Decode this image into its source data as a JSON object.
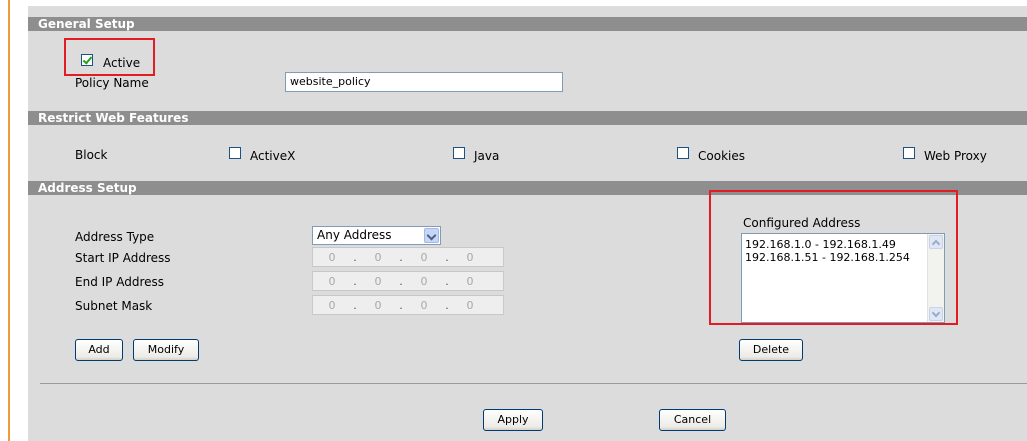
{
  "general_setup": {
    "title": "General Setup",
    "active_label": "Active",
    "active_checked": true,
    "policy_name_label": "Policy Name",
    "policy_name_value": "website_policy"
  },
  "restrict": {
    "title": "Restrict Web Features",
    "block_label": "Block",
    "features": [
      {
        "label": "ActiveX",
        "checked": false
      },
      {
        "label": "Java",
        "checked": false
      },
      {
        "label": "Cookies",
        "checked": false
      },
      {
        "label": "Web Proxy",
        "checked": false
      }
    ]
  },
  "address_setup": {
    "title": "Address Setup",
    "address_type_label": "Address Type",
    "address_type_value": "Any Address",
    "start_ip_label": "Start IP Address",
    "end_ip_label": "End IP Address",
    "subnet_mask_label": "Subnet Mask",
    "start_ip": [
      "0",
      "0",
      "0",
      "0"
    ],
    "end_ip": [
      "0",
      "0",
      "0",
      "0"
    ],
    "subnet_mask": [
      "0",
      "0",
      "0",
      "0"
    ],
    "add_label": "Add",
    "modify_label": "Modify",
    "configured_title": "Configured Address",
    "configured": [
      "192.168.1.0 - 192.168.1.49",
      "192.168.1.51 - 192.168.1.254"
    ],
    "delete_label": "Delete"
  },
  "footer": {
    "apply_label": "Apply",
    "cancel_label": "Cancel"
  },
  "colors": {
    "section_bar": "#8e8e8e",
    "panel": "#dcdcdc",
    "highlight": "#e31b23",
    "left_border": "#ef9a3c"
  }
}
